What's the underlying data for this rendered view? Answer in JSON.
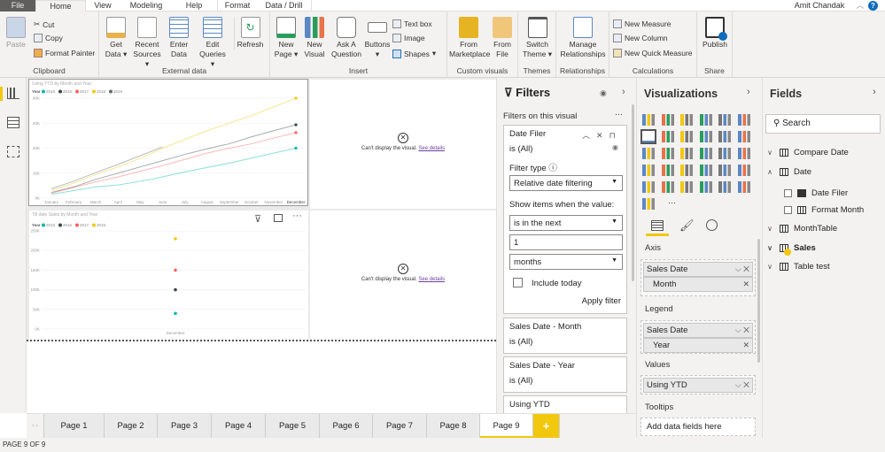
{
  "tabs": {
    "file": "File",
    "home": "Home",
    "view": "View",
    "modeling": "Modeling",
    "help": "Help",
    "format": "Format",
    "data_drill": "Data / Drill"
  },
  "user": {
    "name": "Amit Chandak"
  },
  "ribbon": {
    "clipboard": {
      "label": "Clipboard",
      "paste": "Paste",
      "cut": "Cut",
      "copy": "Copy",
      "format_painter": "Format Painter"
    },
    "external": {
      "label": "External data",
      "get_data": "Get Data",
      "recent": "Recent Sources",
      "enter": "Enter Data",
      "edit": "Edit Queries",
      "refresh": "Refresh"
    },
    "insert": {
      "label": "Insert",
      "new_page": "New Page",
      "new_visual": "New Visual",
      "ask": "Ask A Question",
      "buttons": "Buttons",
      "text_box": "Text box",
      "image": "Image",
      "shapes": "Shapes"
    },
    "custom": {
      "label": "Custom visuals",
      "marketplace": "From Marketplace",
      "file": "From File"
    },
    "themes": {
      "label": "Themes",
      "switch": "Switch Theme"
    },
    "relationships": {
      "label": "Relationships",
      "manage": "Manage Relationships"
    },
    "calculations": {
      "label": "Calculations",
      "measure": "New Measure",
      "column": "New Column",
      "quick": "New Quick Measure"
    },
    "share": {
      "label": "Share",
      "publish": "Publish"
    }
  },
  "canvas": {
    "error_text": "Can't display the visual.",
    "error_link": "See details"
  },
  "chart_data": [
    {
      "type": "line",
      "title": "Using YTD by Month and Year",
      "legend_title": "Year",
      "legend": "top-left",
      "categories": [
        "January",
        "February",
        "March",
        "April",
        "May",
        "June",
        "July",
        "August",
        "September",
        "October",
        "November",
        "December"
      ],
      "ylim": [
        0,
        80000
      ],
      "yticks": [
        "0K",
        "20K",
        "40K",
        "60K",
        "80K"
      ],
      "ytick_values": [
        0,
        20000,
        40000,
        60000,
        80000
      ],
      "grid": true,
      "series": [
        {
          "name": "2015",
          "color": "#01B8AA",
          "values": [
            3000,
            6000,
            9000,
            10500,
            13500,
            17000,
            21000,
            24500,
            28000,
            32000,
            36000,
            40000
          ]
        },
        {
          "name": "2016",
          "color": "#374649",
          "values": [
            4500,
            9000,
            15000,
            20000,
            25000,
            30000,
            35000,
            39500,
            43500,
            49000,
            54000,
            58700
          ]
        },
        {
          "name": "2017",
          "color": "#FD625E",
          "values": [
            4000,
            8500,
            13000,
            17000,
            21500,
            26000,
            31000,
            36000,
            40000,
            43500,
            48000,
            52500
          ]
        },
        {
          "name": "2018",
          "color": "#F2C80F",
          "values": [
            6000,
            12000,
            19000,
            25000,
            32000,
            40000,
            47000,
            54000,
            60000,
            66000,
            73000,
            80000
          ]
        },
        {
          "name": "2019",
          "color": "#5F6B6D",
          "values": [
            7500,
            13500,
            20500,
            27000,
            34000,
            41000,
            null,
            null,
            null,
            null,
            null,
            null
          ]
        }
      ]
    },
    {
      "type": "scatter",
      "title": "Till date Sales by Month and Year",
      "legend_title": "Year",
      "legend": "top-left",
      "categories": [
        "December"
      ],
      "ylim": [
        0,
        250000
      ],
      "yticks": [
        "0K",
        "50K",
        "100K",
        "150K",
        "200K",
        "250K"
      ],
      "ytick_values": [
        0,
        50000,
        100000,
        150000,
        200000,
        250000
      ],
      "grid": true,
      "series": [
        {
          "name": "2015",
          "color": "#01B8AA",
          "values": [
            40000
          ]
        },
        {
          "name": "2016",
          "color": "#374649",
          "values": [
            100000
          ]
        },
        {
          "name": "2017",
          "color": "#FD625E",
          "values": [
            150000
          ]
        },
        {
          "name": "2018",
          "color": "#F2C80F",
          "values": [
            230000
          ]
        }
      ]
    }
  ],
  "filters": {
    "title": "Filters",
    "section": "Filters on this visual",
    "more": "···",
    "card": {
      "name": "Date Filer",
      "state": "is (All)",
      "filter_type_label": "Filter type",
      "filter_type": "Relative date filtering",
      "show_label": "Show items when the value:",
      "condition": "is in the next",
      "amount": "1",
      "unit": "months",
      "include_today": "Include today",
      "apply": "Apply filter"
    },
    "others": [
      {
        "name": "Sales Date - Month",
        "state": "is (All)"
      },
      {
        "name": "Sales Date - Year",
        "state": "is (All)"
      },
      {
        "name": "Using YTD",
        "state": ""
      }
    ]
  },
  "viz": {
    "title": "Visualizations",
    "more": "···",
    "axis_label": "Axis",
    "axis_field": "Sales Date",
    "axis_sub": "Month",
    "legend_label": "Legend",
    "legend_field": "Sales Date",
    "legend_sub": "Year",
    "values_label": "Values",
    "values_field": "Using YTD",
    "tooltips_label": "Tooltips",
    "tooltips_placeholder": "Add data fields here",
    "selected_visual": "line-chart",
    "accent": "#F2C80F"
  },
  "fields": {
    "title": "Fields",
    "search_placeholder": "Search",
    "tables": [
      "Compare Date",
      "Date",
      "MonthTable",
      "Sales",
      "Table test"
    ],
    "date_children": [
      "Date Filer",
      "Format Month"
    ]
  },
  "pages": {
    "tabs": [
      "Page 1",
      "Page 2",
      "Page 3",
      "Page 4",
      "Page 5",
      "Page 6",
      "Page 7",
      "Page 8",
      "Page 9"
    ],
    "selected": "Page 9",
    "add": "+"
  },
  "status": "PAGE 9 OF 9"
}
